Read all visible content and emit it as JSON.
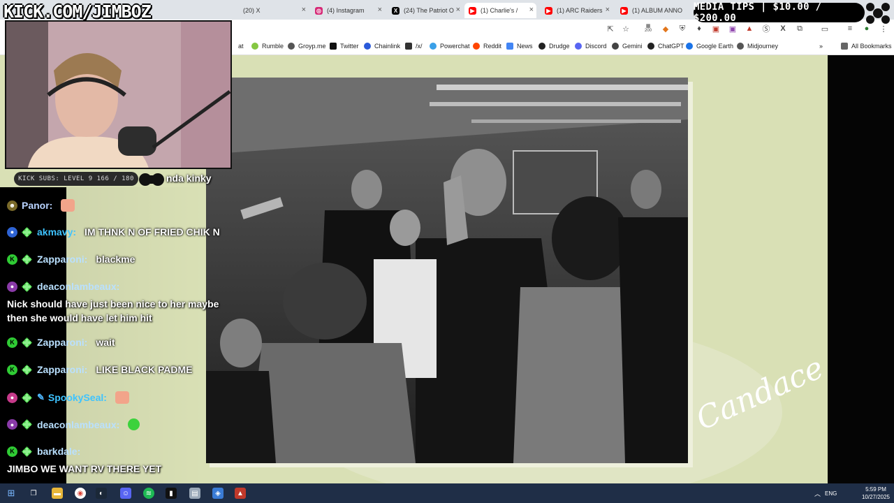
{
  "browser": {
    "tabs": [
      {
        "label": "(20) X",
        "icon": "x-icon",
        "color": "#000000"
      },
      {
        "label": "(4) Instagram",
        "icon": "instagram-icon",
        "color": "#d62976"
      },
      {
        "label": "(24) The Patriot O",
        "icon": "x-icon",
        "color": "#000000"
      },
      {
        "label": "(1) Charlie's /",
        "icon": "youtube-icon",
        "color": "#ff0000"
      },
      {
        "label": "(1) ARC Raiders",
        "icon": "youtube-icon",
        "color": "#ff0000"
      },
      {
        "label": "(1) ALBUM ANNO",
        "icon": "youtube-icon",
        "color": "#ff0000"
      }
    ],
    "active_tab": 3,
    "toolbar_badge": "200",
    "bookmarks": [
      {
        "label": "at"
      },
      {
        "label": "Rumble",
        "color": "#85c742"
      },
      {
        "label": "Groyp.me",
        "color": "#555555"
      },
      {
        "label": "Twitter",
        "color": "#111111"
      },
      {
        "label": "Chainlink",
        "color": "#2a5ada"
      },
      {
        "label": "/x/",
        "color": "#333333"
      },
      {
        "label": "Powerchat",
        "color": "#3aa0e8"
      },
      {
        "label": "Reddit",
        "color": "#ff4500"
      },
      {
        "label": "News",
        "color": "#4285f4"
      },
      {
        "label": "Drudge",
        "color": "#222222"
      },
      {
        "label": "Discord",
        "color": "#5865f2"
      },
      {
        "label": "Gemini",
        "color": "#444444"
      },
      {
        "label": "ChatGPT",
        "color": "#222222"
      },
      {
        "label": "Google Earth",
        "color": "#1a73e8"
      },
      {
        "label": "Midjourney",
        "color": "#555555"
      }
    ],
    "all_bookmarks": "All Bookmarks"
  },
  "overlay": {
    "logo": "KICK.COM/JIMBOZ",
    "subs": "KICK SUBS: LEVEL 9 166 / 180",
    "ticker": "nda kinky",
    "media_tips": "MEDIA TIPS | $10.00 / $200.00"
  },
  "chat": [
    {
      "user": "Panor:",
      "badges": [
        "gold"
      ],
      "user_color": "#b9d3ff",
      "msg": "",
      "emote": "#f2a48a"
    },
    {
      "user": "akmavy:",
      "badges": [
        "blue",
        "diamond"
      ],
      "user_color": "#3ec3ff",
      "msg": "IM THNK N OF FRIED CHIK N"
    },
    {
      "user": "Zapparoni:",
      "badges": [
        "k",
        "diamond"
      ],
      "user_color": "#b9e0ff",
      "msg": "blackme"
    },
    {
      "user": "deaconlambeaux:",
      "badges": [
        "purple",
        "diamond"
      ],
      "user_color": "#b9e0ff",
      "msg": "",
      "block": "Nick should have just been nice to her maybe then she would have let him hit"
    },
    {
      "user": "Zapparoni:",
      "badges": [
        "k",
        "diamond"
      ],
      "user_color": "#b9e0ff",
      "msg": "wait"
    },
    {
      "user": "Zapparoni:",
      "badges": [
        "k",
        "diamond"
      ],
      "user_color": "#b9e0ff",
      "msg": "LIKE BLACK PADME"
    },
    {
      "user": "SpookySeal:",
      "badges": [
        "pink",
        "diamond",
        "syringe"
      ],
      "user_color": "#3ec3ff",
      "msg": "",
      "emote": "#f2a48a"
    },
    {
      "user": "deaconlambeaux:",
      "badges": [
        "purple",
        "diamond"
      ],
      "user_color": "#b9e0ff",
      "msg": "",
      "emote": "#3cd23c"
    },
    {
      "user": "barkdale:",
      "badges": [
        "k",
        "diamond"
      ],
      "user_color": "#b9e0ff",
      "msg": "",
      "block": "JIMBO WE WANT RV THERE YET"
    }
  ],
  "page": {
    "signature": "Candace",
    "accent": "#d9e0b5"
  },
  "taskbar": {
    "lang": "ENG",
    "time": "5:59 PM",
    "date": "10/27/2025",
    "apps": [
      "windows-icon",
      "task-view-icon",
      "file-explorer-icon",
      "chrome-icon",
      "steam-icon",
      "discord-icon",
      "spotify-icon",
      "terminal-icon",
      "app-icon",
      "app-icon",
      "app-icon",
      "app-icon"
    ]
  }
}
